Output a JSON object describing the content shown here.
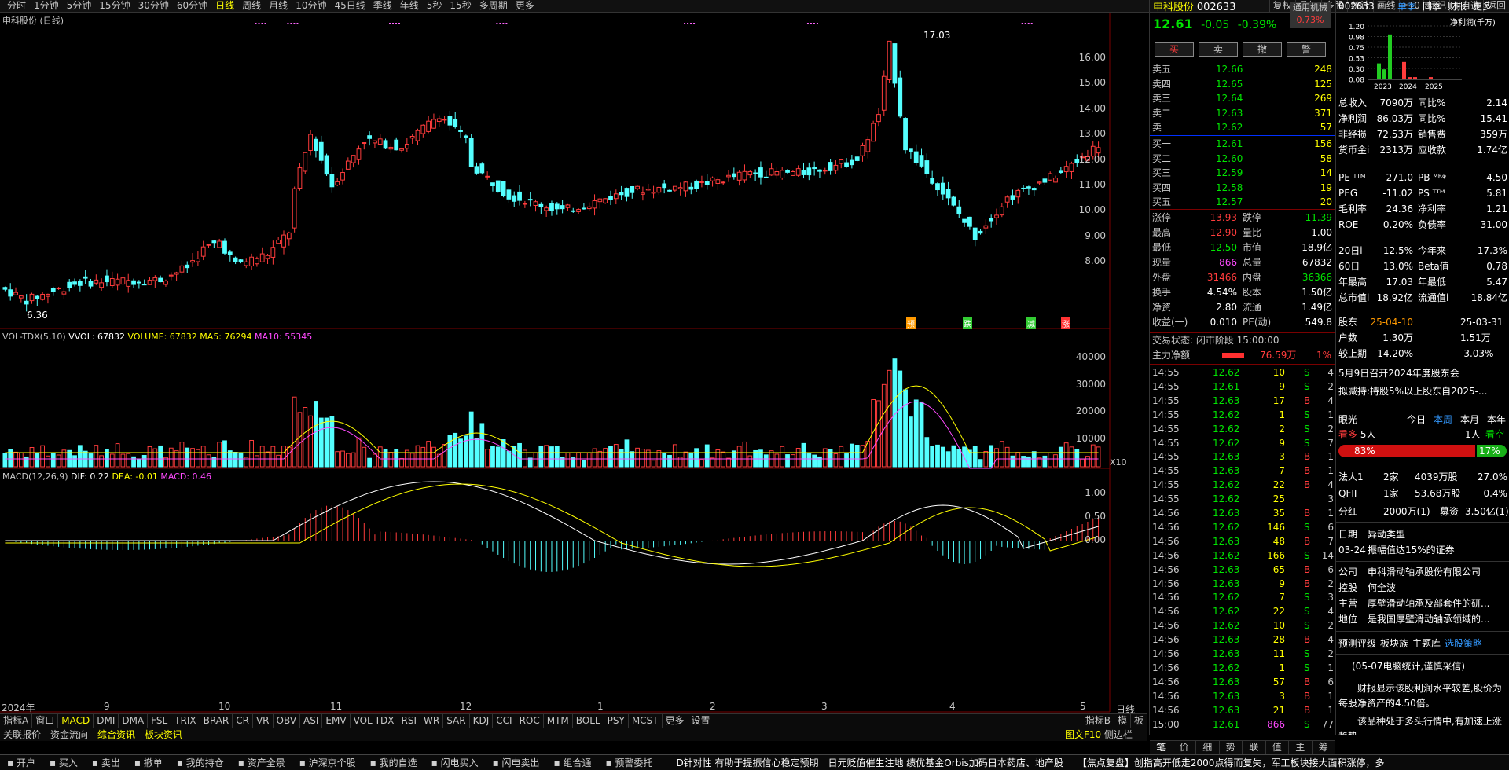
{
  "toolbar": {
    "periods": [
      "分时",
      "1分钟",
      "5分钟",
      "15分钟",
      "30分钟",
      "60分钟",
      "日线",
      "周线",
      "月线",
      "10分钟",
      "45日线",
      "季线",
      "年线",
      "5秒",
      "15秒",
      "多周期",
      "更多"
    ],
    "active_period": "日线",
    "right_tools": [
      "复权",
      "叠加",
      "多股",
      "统计",
      "画线",
      "F10",
      "标记",
      "+自选",
      "返回"
    ]
  },
  "chart": {
    "title": "申科股份 (日线)",
    "price_axis": [
      "16.00",
      "15.00",
      "14.00",
      "13.00",
      "12.00",
      "11.00",
      "10.00",
      "9.00",
      "8.00"
    ],
    "high_label": "17.03",
    "low_label": "6.36",
    "markers": [
      "预",
      "跌",
      "减",
      "涨"
    ],
    "vol_title": "VOL-TDX(5,10)",
    "vol_vvol": "VVOL: 67832",
    "vol_volume": "VOLUME: 67832",
    "vol_ma5": "MA5: 76294",
    "vol_ma10": "MA10: 55345",
    "vol_axis": [
      "40000",
      "30000",
      "20000",
      "10000"
    ],
    "vol_unit": "X10",
    "macd_title": "MACD(12,26,9)",
    "macd_dif": "DIF: 0.22",
    "macd_dea": "DEA: -0.01",
    "macd_val": "MACD: 0.46",
    "macd_axis": [
      "1.00",
      "0.50",
      "0.00"
    ],
    "date_axis": [
      "2024年",
      "9",
      "10",
      "11",
      "12",
      "1",
      "2",
      "3",
      "4",
      "5"
    ],
    "date_corner": "日线",
    "indicator_corner": "指标B",
    "template_corner": "模",
    "template_corner2": "板"
  },
  "indicator_tabs": [
    "指标A",
    "窗口",
    "MACD",
    "DMI",
    "DMA",
    "FSL",
    "TRIX",
    "BRAR",
    "CR",
    "VR",
    "OBV",
    "ASI",
    "EMV",
    "VOL-TDX",
    "RSI",
    "WR",
    "SAR",
    "KDJ",
    "CCI",
    "ROC",
    "MTM",
    "BOLL",
    "PSY",
    "MCST",
    "更多",
    "设置"
  ],
  "indicator_active": "MACD",
  "info_tabs": [
    "关联报价",
    "资金流向",
    "综合资讯",
    "板块资讯"
  ],
  "info_right": "图文F10",
  "info_right2": "侧边栏",
  "quote": {
    "name": "申科股份",
    "code": "002633",
    "tag": "通用机械",
    "tag_pct": "0.73%",
    "price": "12.61",
    "change": "-0.05",
    "change_pct": "-0.39%",
    "buttons": [
      "买",
      "卖",
      "撤",
      "警"
    ],
    "asks": [
      {
        "label": "卖五",
        "price": "12.66",
        "vol": "248"
      },
      {
        "label": "卖四",
        "price": "12.65",
        "vol": "125"
      },
      {
        "label": "卖三",
        "price": "12.64",
        "vol": "269"
      },
      {
        "label": "卖二",
        "price": "12.63",
        "vol": "371"
      },
      {
        "label": "卖一",
        "price": "12.62",
        "vol": "57"
      }
    ],
    "bids": [
      {
        "label": "买一",
        "price": "12.61",
        "vol": "156"
      },
      {
        "label": "买二",
        "price": "12.60",
        "vol": "58"
      },
      {
        "label": "买三",
        "price": "12.59",
        "vol": "14"
      },
      {
        "label": "买四",
        "price": "12.58",
        "vol": "19"
      },
      {
        "label": "买五",
        "price": "12.57",
        "vol": "20"
      }
    ],
    "stats": [
      {
        "l1": "涨停",
        "v1": "13.93",
        "c1": "red",
        "l2": "跌停",
        "v2": "11.39",
        "c2": "green"
      },
      {
        "l1": "最高",
        "v1": "12.90",
        "c1": "red",
        "l2": "量比",
        "v2": "1.00",
        "c2": "white"
      },
      {
        "l1": "最低",
        "v1": "12.50",
        "c1": "green",
        "l2": "市值",
        "v2": "18.9亿",
        "c2": "white"
      },
      {
        "l1": "现量",
        "v1": "866",
        "c1": "magenta",
        "l2": "总量",
        "v2": "67832",
        "c2": "white"
      },
      {
        "l1": "外盘",
        "v1": "31466",
        "c1": "red",
        "l2": "内盘",
        "v2": "36366",
        "c2": "green"
      },
      {
        "l1": "换手",
        "v1": "4.54%",
        "c1": "white",
        "l2": "股本",
        "v2": "1.50亿",
        "c2": "white"
      },
      {
        "l1": "净资",
        "v1": "2.80",
        "c1": "white",
        "l2": "流通",
        "v2": "1.49亿",
        "c2": "white"
      },
      {
        "l1": "收益(一)",
        "v1": "0.010",
        "c1": "white",
        "l2": "PE(动)",
        "v2": "549.8",
        "c2": "white"
      }
    ],
    "trade_status": "交易状态: 闭市阶段 15:00:00",
    "flow_label": "主力净额",
    "flow_value": "76.59万",
    "flow_pct": "1%",
    "ticks": [
      {
        "t": "14:55",
        "p": "12.62",
        "v": "10",
        "s": "S",
        "n": "4"
      },
      {
        "t": "14:55",
        "p": "12.61",
        "v": "9",
        "s": "S",
        "n": "2"
      },
      {
        "t": "14:55",
        "p": "12.63",
        "v": "17",
        "s": "B",
        "n": "4"
      },
      {
        "t": "14:55",
        "p": "12.62",
        "v": "1",
        "s": "S",
        "n": "1"
      },
      {
        "t": "14:55",
        "p": "12.62",
        "v": "2",
        "s": "S",
        "n": "2"
      },
      {
        "t": "14:55",
        "p": "12.62",
        "v": "9",
        "s": "S",
        "n": "7"
      },
      {
        "t": "14:55",
        "p": "12.63",
        "v": "3",
        "s": "B",
        "n": "1"
      },
      {
        "t": "14:55",
        "p": "12.63",
        "v": "7",
        "s": "B",
        "n": "1"
      },
      {
        "t": "14:55",
        "p": "12.62",
        "v": "22",
        "s": "B",
        "n": "4"
      },
      {
        "t": "14:55",
        "p": "12.62",
        "v": "25",
        "s": "",
        "n": "3"
      },
      {
        "t": "14:56",
        "p": "12.63",
        "v": "35",
        "s": "B",
        "n": "1"
      },
      {
        "t": "14:56",
        "p": "12.62",
        "v": "146",
        "s": "S",
        "n": "6"
      },
      {
        "t": "14:56",
        "p": "12.63",
        "v": "48",
        "s": "B",
        "n": "7"
      },
      {
        "t": "14:56",
        "p": "12.62",
        "v": "166",
        "s": "S",
        "n": "14"
      },
      {
        "t": "14:56",
        "p": "12.63",
        "v": "65",
        "s": "B",
        "n": "6"
      },
      {
        "t": "14:56",
        "p": "12.63",
        "v": "9",
        "s": "B",
        "n": "2"
      },
      {
        "t": "14:56",
        "p": "12.62",
        "v": "7",
        "s": "S",
        "n": "3"
      },
      {
        "t": "14:56",
        "p": "12.62",
        "v": "22",
        "s": "S",
        "n": "4"
      },
      {
        "t": "14:56",
        "p": "12.62",
        "v": "10",
        "s": "S",
        "n": "2"
      },
      {
        "t": "14:56",
        "p": "12.63",
        "v": "28",
        "s": "B",
        "n": "4"
      },
      {
        "t": "14:56",
        "p": "12.63",
        "v": "11",
        "s": "S",
        "n": "2"
      },
      {
        "t": "14:56",
        "p": "12.62",
        "v": "1",
        "s": "S",
        "n": "1"
      },
      {
        "t": "14:56",
        "p": "12.63",
        "v": "57",
        "s": "B",
        "n": "6"
      },
      {
        "t": "14:56",
        "p": "12.63",
        "v": "3",
        "s": "B",
        "n": "1"
      },
      {
        "t": "14:56",
        "p": "12.63",
        "v": "21",
        "s": "B",
        "n": "1"
      },
      {
        "t": "15:00",
        "p": "12.61",
        "v": "866",
        "s": "S",
        "n": "77"
      }
    ],
    "bottom_tabs": [
      "笔",
      "价",
      "细",
      "势",
      "联",
      "值",
      "主",
      "筹"
    ]
  },
  "f10": {
    "code": "002633",
    "tabs": [
      "单季",
      "同季",
      "财报",
      "更多"
    ],
    "chart_unit": "净利润(千万)",
    "bar_axis": [
      "1.20",
      "0.98",
      "0.75",
      "0.53",
      "0.30",
      "0.08"
    ],
    "bar_years": [
      "2023",
      "2024",
      "2025"
    ],
    "fin_rows": [
      {
        "l1": "总收入",
        "v1": "7090万",
        "l2": "同比%",
        "v2": "2.14"
      },
      {
        "l1": "净利润",
        "v1": "86.03万",
        "l2": "同比%",
        "v2": "15.41"
      },
      {
        "l1": "非经损",
        "v1": "72.53万",
        "l2": "销售费",
        "v2": "359万"
      },
      {
        "l1": "货币金i",
        "v1": "2313万",
        "l2": "应收款",
        "v2": "1.74亿"
      }
    ],
    "val_rows": [
      {
        "l1": "PE ᵀᵀᴹ",
        "v1": "271.0",
        "l2": "PB ᴹᴿᵠ",
        "v2": "4.50"
      },
      {
        "l1": "PEG",
        "v1": "-11.02",
        "l2": "PS ᵀᵀᴹ",
        "v2": "5.81"
      },
      {
        "l1": "毛利率",
        "v1": "24.36",
        "l2": "净利率",
        "v2": "1.21"
      },
      {
        "l1": "ROE",
        "v1": "0.20%",
        "l2": "负债率",
        "v2": "31.00"
      }
    ],
    "perf_rows": [
      {
        "l1": "20日i",
        "v1": "12.5%",
        "l2": "今年来",
        "v2": "17.3%"
      },
      {
        "l1": "60日",
        "v1": "13.0%",
        "l2": "Beta值",
        "v2": "0.78"
      },
      {
        "l1": "年最高",
        "v1": "17.03",
        "l2": "年最低",
        "v2": "5.47"
      },
      {
        "l1": "总市值i",
        "v1": "18.92亿",
        "l2": "流通值i",
        "v2": "18.84亿"
      }
    ],
    "holder_rows": [
      {
        "l1": "股东",
        "v1": "25-04-10",
        "l2": "25-03-31",
        "v1c": "orange"
      },
      {
        "l1": "户数",
        "v1": "1.30万",
        "l2": "1.51万"
      },
      {
        "l1": "较上期",
        "v1": "-14.20%",
        "l2": "-3.03%"
      }
    ],
    "news1": "5月9日召开2024年度股东会",
    "news2": "拟减持:持股5%以上股东自2025-...",
    "view_label": "眼光",
    "view_tabs": [
      "今日",
      "本周",
      "本月",
      "本年"
    ],
    "view_bull_label": "看多",
    "view_bull_count": "5人",
    "view_bear_count": "1人",
    "view_bear_label": "看空",
    "view_bull_pct": "83%",
    "view_bear_pct": "17%",
    "inst_rows": [
      {
        "l1": "法人1",
        "v1": "2家",
        "v2": "4039万股",
        "v3": "27.0%"
      },
      {
        "l1": "QFII",
        "v1": "1家",
        "v2": "53.68万股",
        "v3": "0.4%"
      }
    ],
    "div_label": "分红",
    "div_val": "2000万(1)",
    "raise_label": "募资",
    "raise_val": "3.50亿(1)",
    "abn_head1": "日期",
    "abn_head2": "异动类型",
    "abn_date": "03-24",
    "abn_type": "振幅值达15%的证券",
    "company_rows": [
      {
        "l": "公司",
        "v": "申科滑动轴承股份有限公司"
      },
      {
        "l": "控股",
        "v": "何全波"
      },
      {
        "l": "主营",
        "v": "厚壁滑动轴承及部套件的研..."
      },
      {
        "l": "地位",
        "v": "是我国厚壁滑动轴承领域的..."
      }
    ],
    "links": [
      "预测评级",
      "板块族",
      "主题库",
      "选股策略"
    ],
    "report_title": "(05-07电脑统计,谨慎采信)",
    "report_p1": "财报显示该股利润水平较差,股价为每股净资产的4.50倍。",
    "report_p2": "该品种处于多头行情中,有加速上涨趋势。",
    "report_p3": "DMA指标显示..."
  },
  "bottom_bar": [
    "开户",
    "买入",
    "卖出",
    "撤单",
    "我的持仓",
    "资产全景",
    "沪深京个股",
    "我的自选",
    "闪电买入",
    "闪电卖出",
    "组合通",
    "预警委托"
  ],
  "ticker_news": "D针对性 有助于提振信心稳定预期　日元贬值催生注地 绩优基金Orbis加码日本药店、地产股",
  "ticker_news2": "【焦点复盘】创指高开低走2000点得而复失，军工板块接大面积涨停，多",
  "colors": {
    "up": "#ff3c3c",
    "down": "#54ffff",
    "ma5": "#ffff00",
    "ma10": "#ff4aff",
    "accent": "#ffff00"
  }
}
